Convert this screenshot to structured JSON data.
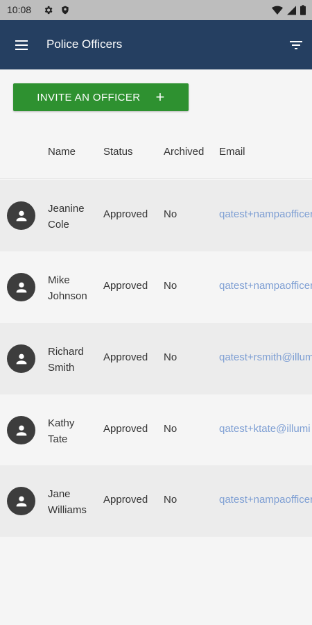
{
  "status_bar": {
    "time": "10:08",
    "icons": [
      "gear-icon",
      "shield-icon",
      "wifi-icon",
      "signal-icon",
      "battery-icon"
    ]
  },
  "app_bar": {
    "title": "Police Officers",
    "background": "#253f61",
    "menu_icon": "menu-icon",
    "filter_icon": "filter-icon"
  },
  "invite_button": {
    "label": "INVITE AN OFFICER",
    "icon": "+",
    "color": "#2e9130"
  },
  "table": {
    "columns": [
      "Name",
      "Status",
      "Archived",
      "Email"
    ],
    "rows": [
      {
        "first": "Jeanine",
        "last": "Cole",
        "status": "Approved",
        "archived": "No",
        "email": "qatest+nampaofficer"
      },
      {
        "first": "Mike",
        "last": "Johnson",
        "status": "Approved",
        "archived": "No",
        "email": "qatest+nampaofficer"
      },
      {
        "first": "Richard",
        "last": "Smith",
        "status": "Approved",
        "archived": "No",
        "email": "qatest+rsmith@illum"
      },
      {
        "first": "Kathy",
        "last": "Tate",
        "status": "Approved",
        "archived": "No",
        "email": "qatest+ktate@illumi"
      },
      {
        "first": "Jane",
        "last": "Williams",
        "status": "Approved",
        "archived": "No",
        "email": "qatest+nampaofficer"
      }
    ],
    "link_color": "#7d9ed3"
  }
}
